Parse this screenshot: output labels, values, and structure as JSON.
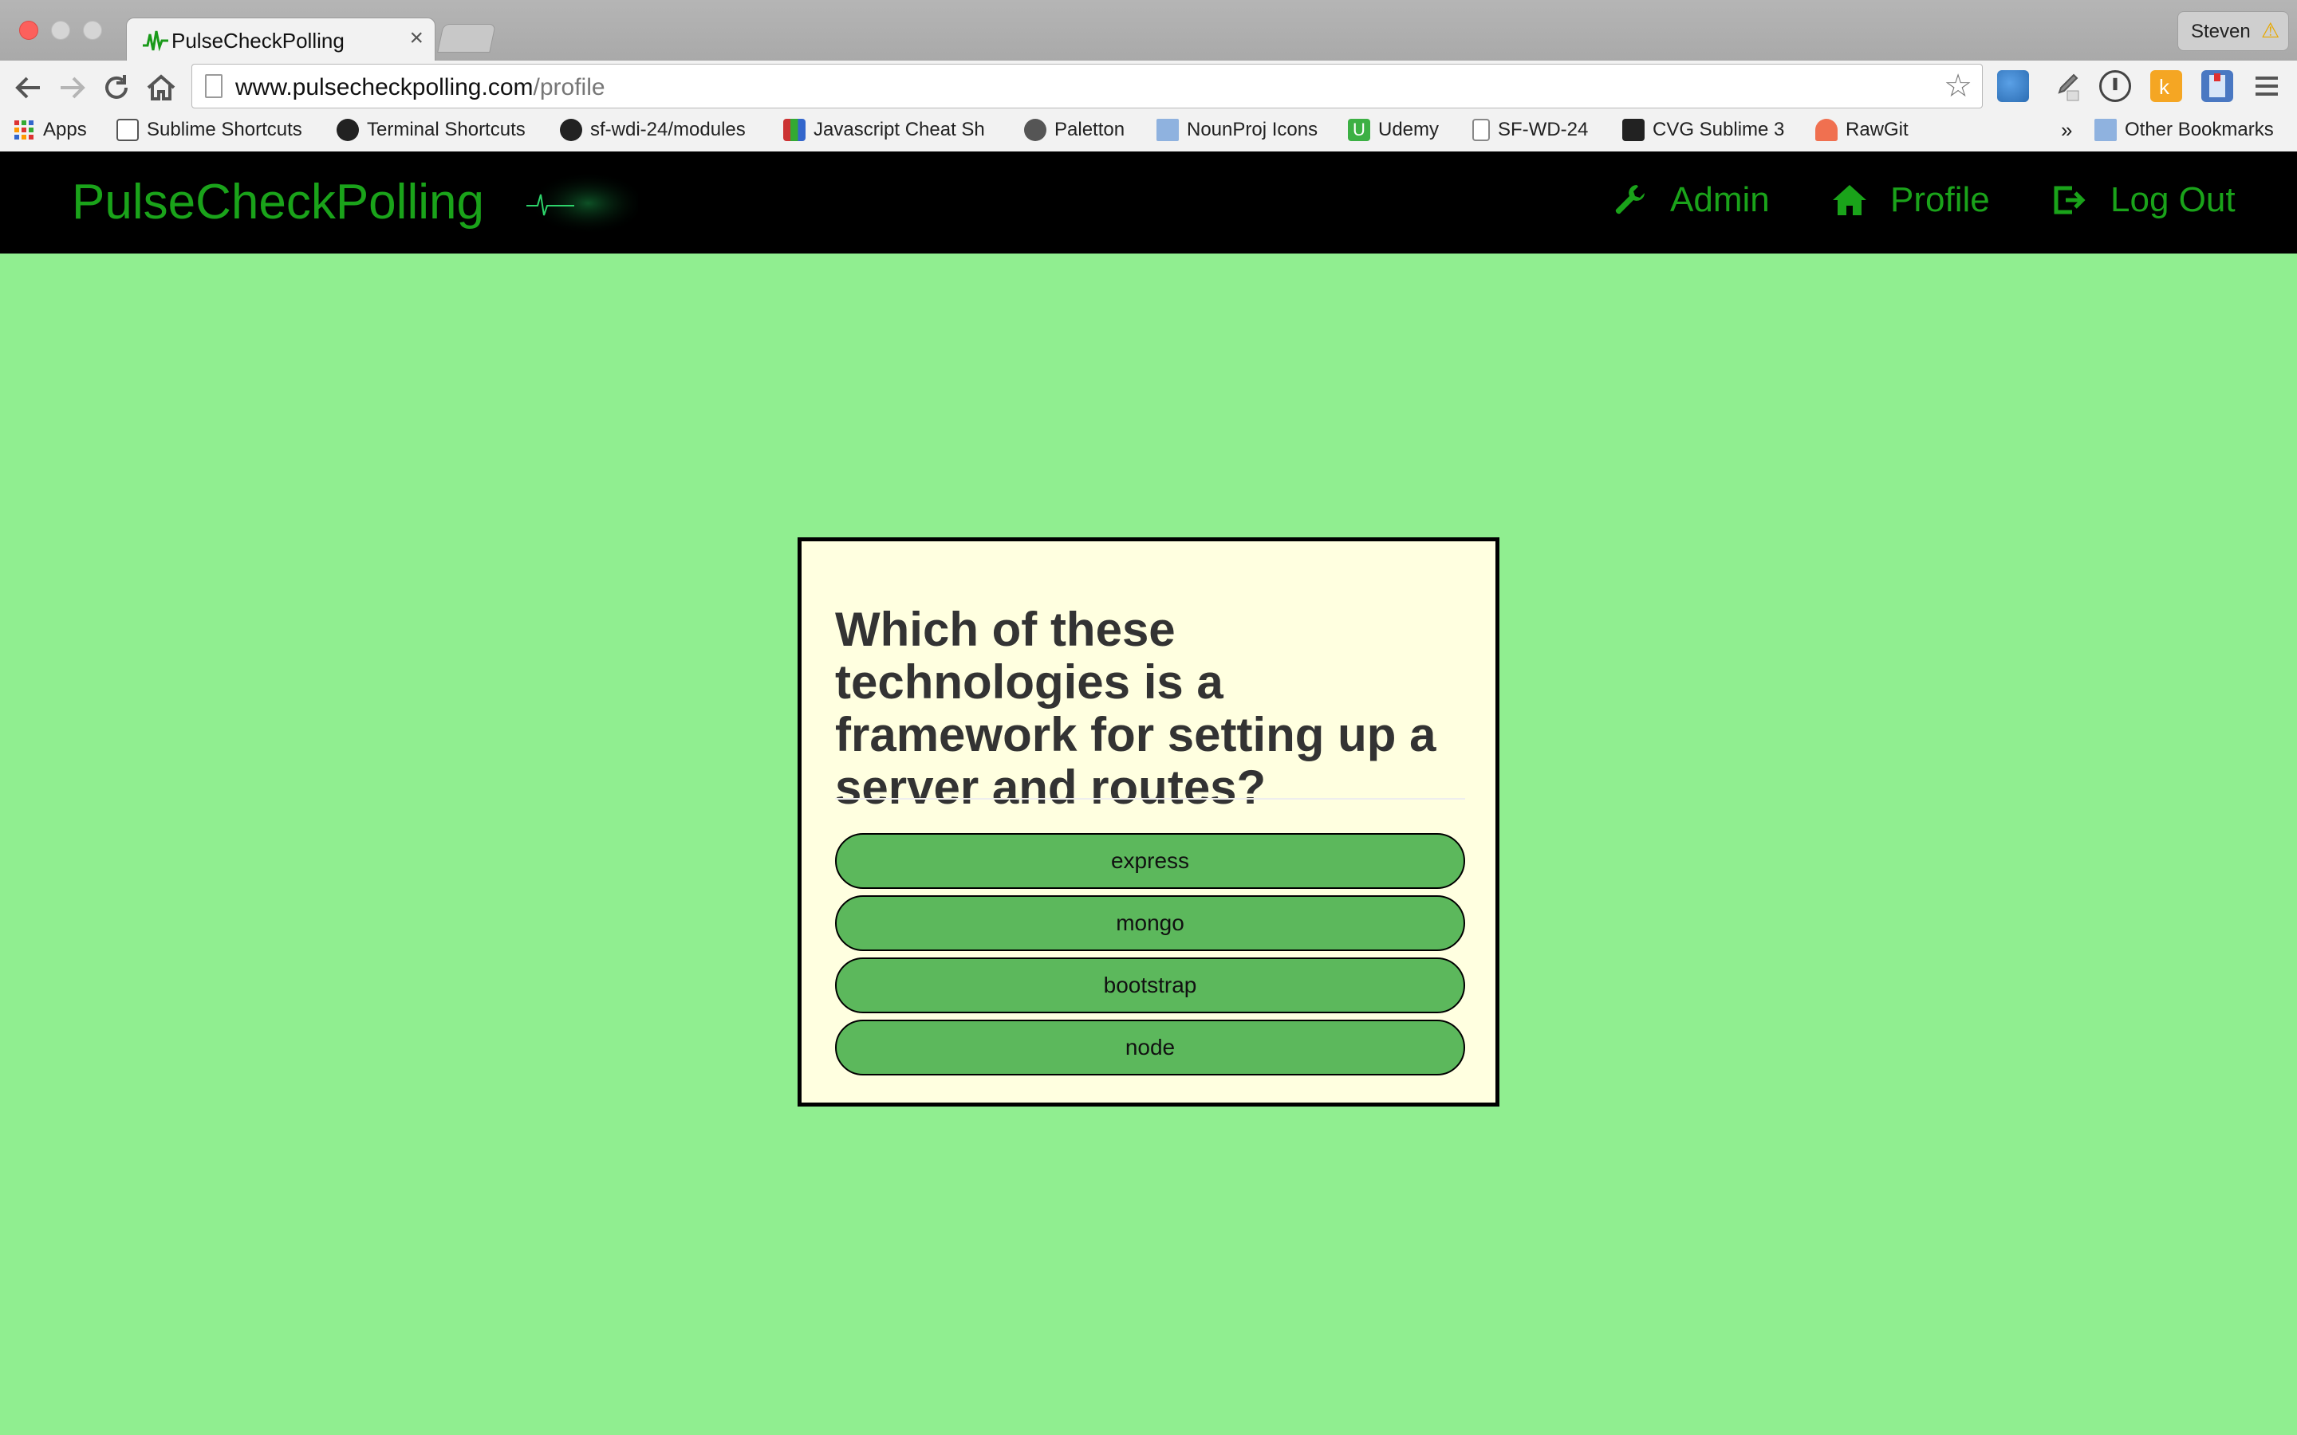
{
  "browser": {
    "tab_title": "PulseCheckPolling",
    "tab_close": "×",
    "profile_name": "Steven",
    "url_host": "www.pulsecheckpolling.com",
    "url_path": "/profile",
    "bookmarks": [
      {
        "label": "Apps",
        "icon": "apps-grid-icon"
      },
      {
        "label": "Sublime Shortcuts",
        "icon": "sublime-icon"
      },
      {
        "label": "Terminal Shortcuts",
        "icon": "github-icon"
      },
      {
        "label": "sf-wdi-24/modules",
        "icon": "github-icon"
      },
      {
        "label": "Javascript Cheat Sh",
        "icon": "cheatsheet-icon"
      },
      {
        "label": "Paletton",
        "icon": "paletton-icon"
      },
      {
        "label": "NounProj Icons",
        "icon": "folder-icon"
      },
      {
        "label": "Udemy",
        "icon": "udemy-icon"
      },
      {
        "label": "SF-WD-24",
        "icon": "page-icon"
      },
      {
        "label": "CVG Sublime 3",
        "icon": "cvg-icon"
      },
      {
        "label": "RawGit",
        "icon": "rawgit-icon"
      }
    ],
    "overflow": "»",
    "other_bookmarks": "Other Bookmarks"
  },
  "navbar": {
    "brand": "PulseCheckPolling",
    "links": [
      {
        "label": "Admin",
        "icon": "wrench-icon"
      },
      {
        "label": "Profile",
        "icon": "home-icon"
      },
      {
        "label": "Log Out",
        "icon": "logout-icon"
      }
    ]
  },
  "poll": {
    "question": "Which of these technologies is a framework for setting up a server and routes?",
    "options": [
      "express",
      "mongo",
      "bootstrap",
      "node"
    ]
  },
  "colors": {
    "page_bg": "#90ee90",
    "navbar_bg": "#000000",
    "brand_green": "#1aa31a",
    "card_bg": "#ffffe0",
    "option_green": "#5cb85c"
  }
}
